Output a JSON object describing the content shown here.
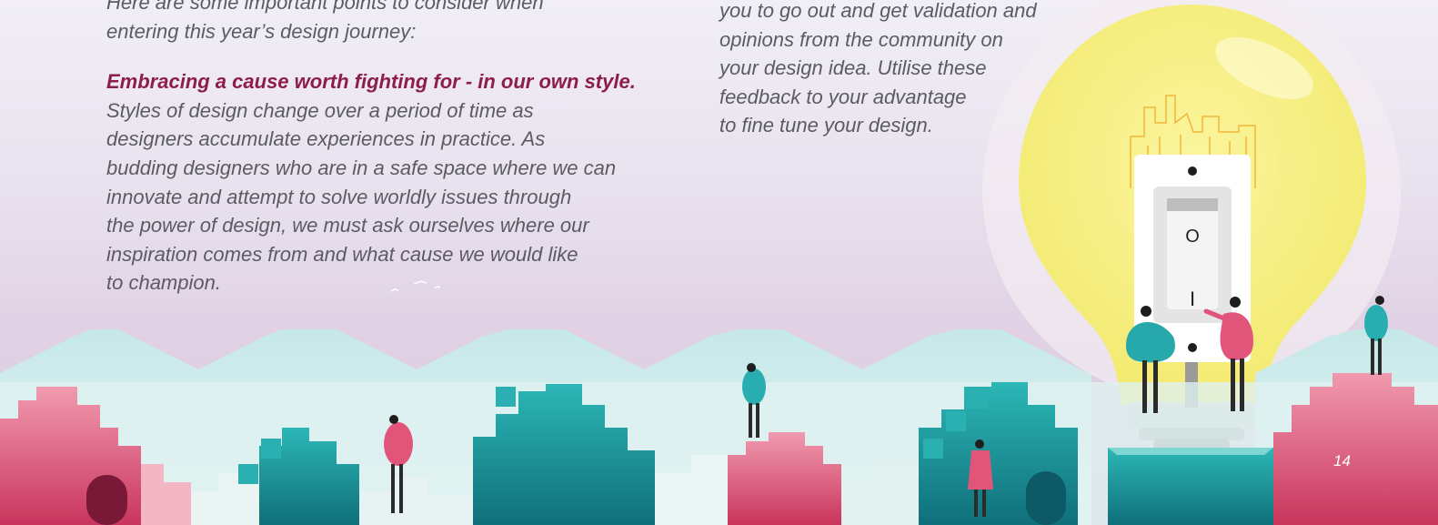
{
  "left_column": {
    "intro_lines": [
      "Here are some important points to consider when",
      "entering this year’s design journey:"
    ],
    "subheading": "Embracing a cause worth fighting for - in our own style.",
    "body_lines": [
      "Styles of design change over a period of time as",
      "designers accumulate experiences in practice. As",
      "budding designers who are in a safe space where we can",
      "innovate and attempt to solve worldly issues through",
      "the power of design, we must ask ourselves where our",
      "inspiration comes from and what cause we would like",
      "to champion."
    ]
  },
  "right_column": {
    "body_lines": [
      "you to go out and get validation and",
      "opinions from the community on",
      "your design idea. Utilise these",
      "feedback to your advantage",
      "to fine tune your design."
    ]
  },
  "switch": {
    "on_symbol": "O",
    "off_symbol": "I"
  },
  "page_number": "14",
  "colors": {
    "subheading": "#8d1d4a",
    "body_text": "#5b5b63",
    "bulb": "#f6ef86",
    "teal": "#2bb3b5",
    "pink": "#e0577c"
  }
}
